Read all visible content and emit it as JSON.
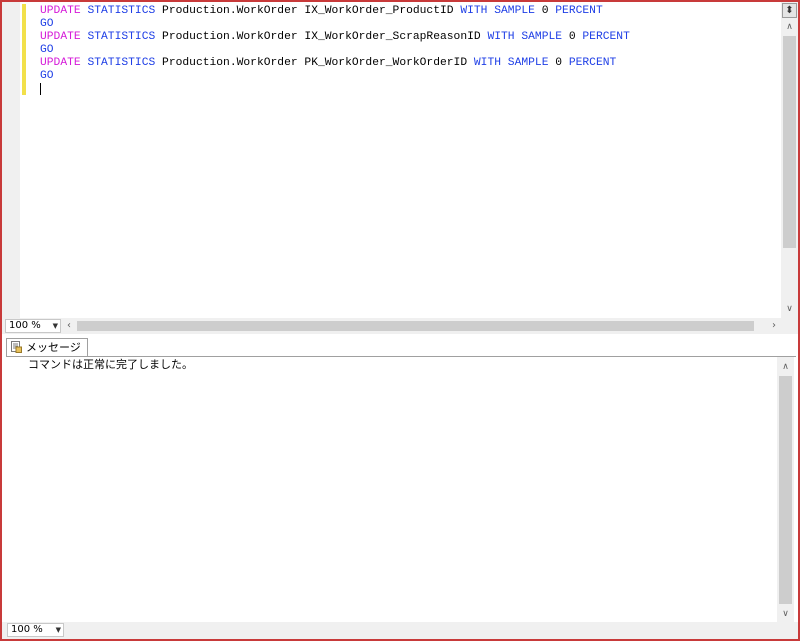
{
  "editor": {
    "lines": [
      [
        {
          "t": "UPDATE",
          "c": "kw2"
        },
        {
          "t": " STATISTICS",
          "c": "kw"
        },
        {
          "t": " Production.WorkOrder IX_WorkOrder_ProductID ",
          "c": ""
        },
        {
          "t": "WITH",
          "c": "kw"
        },
        {
          "t": " ",
          "c": ""
        },
        {
          "t": "SAMPLE",
          "c": "kw"
        },
        {
          "t": " 0 ",
          "c": ""
        },
        {
          "t": "PERCENT",
          "c": "kw"
        }
      ],
      [
        {
          "t": "GO",
          "c": "kw"
        }
      ],
      [
        {
          "t": "UPDATE",
          "c": "kw2"
        },
        {
          "t": " STATISTICS",
          "c": "kw"
        },
        {
          "t": " Production.WorkOrder IX_WorkOrder_ScrapReasonID ",
          "c": ""
        },
        {
          "t": "WITH",
          "c": "kw"
        },
        {
          "t": " ",
          "c": ""
        },
        {
          "t": "SAMPLE",
          "c": "kw"
        },
        {
          "t": " 0 ",
          "c": ""
        },
        {
          "t": "PERCENT",
          "c": "kw"
        }
      ],
      [
        {
          "t": "GO",
          "c": "kw"
        }
      ],
      [
        {
          "t": "UPDATE",
          "c": "kw2"
        },
        {
          "t": " STATISTICS",
          "c": "kw"
        },
        {
          "t": " Production.WorkOrder PK_WorkOrder_WorkOrderID ",
          "c": ""
        },
        {
          "t": "WITH",
          "c": "kw"
        },
        {
          "t": " ",
          "c": ""
        },
        {
          "t": "SAMPLE",
          "c": "kw"
        },
        {
          "t": " 0 ",
          "c": ""
        },
        {
          "t": "PERCENT",
          "c": "kw"
        }
      ],
      [
        {
          "t": "GO",
          "c": "kw"
        }
      ]
    ],
    "zoom": "100 %"
  },
  "results": {
    "tab_label": "メッセージ",
    "message": "コマンドは正常に完了しました。",
    "zoom": "100 %"
  },
  "colors": {
    "keyword": "#1f3fe6",
    "statement_keyword": "#d51ad8",
    "change_bar": "#f2e04a",
    "window_border": "#c83a3a"
  },
  "icons": {
    "split": "split-view-icon",
    "tab": "messages-icon"
  }
}
